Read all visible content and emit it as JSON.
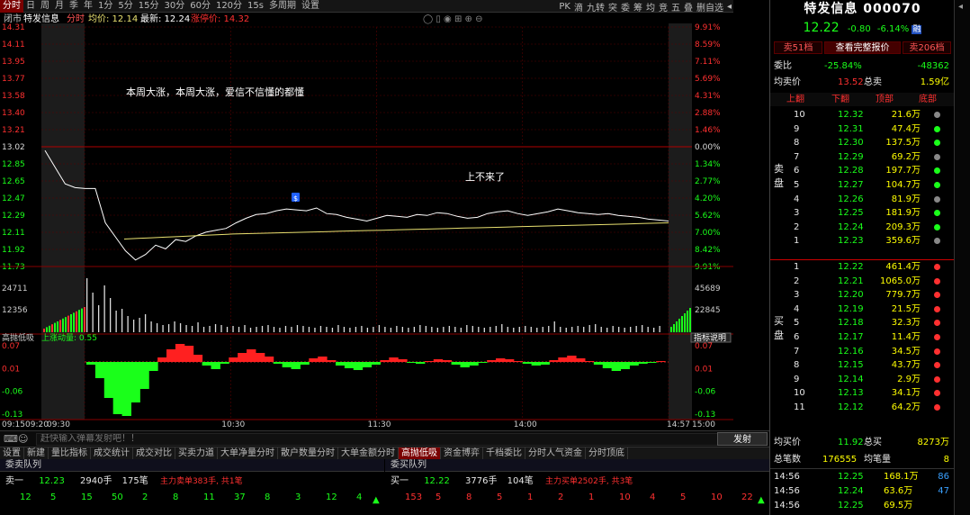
{
  "toolbar": {
    "items": [
      "分时",
      "日",
      "周",
      "月",
      "季",
      "年",
      "1分",
      "5分",
      "15分",
      "30分",
      "60分",
      "120分",
      "15s",
      "多周期",
      "设置"
    ],
    "active_index": 0,
    "right_items": [
      "PK",
      "滴",
      "九转",
      "突",
      "委",
      "筹",
      "均",
      "竞",
      "五",
      "叠",
      "删自选",
      "◂"
    ]
  },
  "chart": {
    "info_line": {
      "status": "闭市",
      "name": "特发信息",
      "mode": "分时",
      "avg_label": "均价: 12.14",
      "latest_label": "最新: 12.24",
      "limit_label": "涨停价: 14.32"
    },
    "annotations": {
      "comment1": "本周大涨，本周大涨，爱信不信懂的都懂",
      "comment2": "上不来了",
      "marker": "$"
    },
    "price_ticks_left": [
      "14.31",
      "14.11",
      "13.95",
      "13.77",
      "13.58",
      "13.40",
      "13.21",
      "13.02",
      "12.85",
      "12.65",
      "12.47",
      "12.29",
      "12.11",
      "11.92",
      "11.73"
    ],
    "pct_ticks_right": [
      "9.91%",
      "8.59%",
      "7.11%",
      "5.69%",
      "4.31%",
      "2.88%",
      "1.46%",
      "0.00%",
      "1.34%",
      "2.77%",
      "4.20%",
      "5.62%",
      "7.00%",
      "8.42%",
      "9.91%"
    ],
    "volume_ticks_left": [
      "24711",
      "12356"
    ],
    "volume_ticks_right": [
      "45689",
      "22845"
    ],
    "indicator_label": "高抛低吸",
    "indicator_sub": "上涨动量: 0.55",
    "indicator_btn": "指标说明",
    "indicator_ticks": [
      "0.07",
      "0.01",
      "-0.06",
      "-0.13"
    ],
    "time_labels": [
      "09:15",
      "09:20",
      "09:30",
      "10:30",
      "11:30",
      "14:00",
      "14:57",
      "15:00"
    ]
  },
  "message": {
    "placeholder": "赶快输入弹幕发射吧！！",
    "send_label": "发射",
    "toggle_label": "弹"
  },
  "tabs": [
    "设置",
    "新建",
    "量比指标",
    "成交统计",
    "成交对比",
    "买卖力道",
    "大单净量分时",
    "散户数量分时",
    "大单金额分时",
    "高抛低吸",
    "资金博弈",
    "千档委比",
    "分时人气资金",
    "分时顶底"
  ],
  "tabs_active": 9,
  "queues": {
    "sell_title": "委卖队列",
    "buy_title": "委买队列",
    "sell_row": {
      "label": "卖一",
      "price": "12.23",
      "vol": "2940手",
      "count": "175笔",
      "note": "主力卖单383手, 共1笔"
    },
    "buy_row": {
      "label": "买一",
      "price": "12.22",
      "vol": "3776手",
      "count": "104笔",
      "note": "主力买单2502手, 共3笔"
    },
    "sell_numbers": [
      "12",
      "5",
      "15",
      "50",
      "2",
      "8",
      "11",
      "37",
      "8",
      "3",
      "12",
      "4"
    ],
    "buy_numbers": [
      "153",
      "5",
      "8",
      "5",
      "1",
      "2",
      "1",
      "10",
      "4",
      "5",
      "10",
      "22"
    ]
  },
  "right_panel": {
    "title": "特发信息  000070",
    "price": "12.22",
    "change": "-0.80",
    "pct": "-6.14%",
    "badge": "融",
    "buttons": [
      "卖51档",
      "查看完整报价",
      "卖206档"
    ],
    "weibi_label": "委比",
    "weibi_value": "-25.84%",
    "weicha_value": "-48362",
    "avg_sell_label": "均卖价",
    "avg_sell_value": "13.52",
    "total_sell_label": "总卖",
    "total_sell_value": "1.59亿",
    "col_heads": [
      "上翻",
      "下翻",
      "顶部",
      "底部"
    ],
    "side_sell": "卖盘",
    "side_buy": "买盘",
    "asks": [
      {
        "lvl": "10",
        "price": "12.32",
        "vol": "21.6万"
      },
      {
        "lvl": "9",
        "price": "12.31",
        "vol": "47.4万"
      },
      {
        "lvl": "8",
        "price": "12.30",
        "vol": "137.5万"
      },
      {
        "lvl": "7",
        "price": "12.29",
        "vol": "69.2万"
      },
      {
        "lvl": "6",
        "price": "12.28",
        "vol": "197.7万"
      },
      {
        "lvl": "5",
        "price": "12.27",
        "vol": "104.7万"
      },
      {
        "lvl": "4",
        "price": "12.26",
        "vol": "81.9万"
      },
      {
        "lvl": "3",
        "price": "12.25",
        "vol": "181.9万"
      },
      {
        "lvl": "2",
        "price": "12.24",
        "vol": "209.3万"
      },
      {
        "lvl": "1",
        "price": "12.23",
        "vol": "359.6万"
      }
    ],
    "bids": [
      {
        "lvl": "1",
        "price": "12.22",
        "vol": "461.4万"
      },
      {
        "lvl": "2",
        "price": "12.21",
        "vol": "1065.0万"
      },
      {
        "lvl": "3",
        "price": "12.20",
        "vol": "779.7万"
      },
      {
        "lvl": "4",
        "price": "12.19",
        "vol": "21.5万"
      },
      {
        "lvl": "5",
        "price": "12.18",
        "vol": "32.3万"
      },
      {
        "lvl": "6",
        "price": "12.17",
        "vol": "11.4万"
      },
      {
        "lvl": "7",
        "price": "12.16",
        "vol": "34.5万"
      },
      {
        "lvl": "8",
        "price": "12.15",
        "vol": "43.7万"
      },
      {
        "lvl": "9",
        "price": "12.14",
        "vol": "2.9万"
      },
      {
        "lvl": "10",
        "price": "12.13",
        "vol": "34.1万"
      },
      {
        "lvl": "11",
        "price": "12.12",
        "vol": "64.2万"
      }
    ],
    "avg_buy_label": "均买价",
    "avg_buy_value": "11.92",
    "total_buy_label": "总买",
    "total_buy_value": "8273万",
    "total_count_label": "总笔数",
    "total_count_value": "176555",
    "avg_vol_label": "均笔量",
    "avg_vol_value": "8",
    "ticks": [
      {
        "time": "14:56",
        "price": "12.25",
        "amt": "168.1万",
        "n": "86"
      },
      {
        "time": "14:56",
        "price": "12.24",
        "amt": "63.6万",
        "n": "47"
      },
      {
        "time": "14:56",
        "price": "12.25",
        "amt": "69.5万",
        "n": ""
      }
    ]
  },
  "colors": {
    "up": "#ff3030",
    "down": "#1aff1a",
    "price_line": "#ffffff",
    "avg_line": "#e8e070",
    "grid": "#5a0000"
  }
}
